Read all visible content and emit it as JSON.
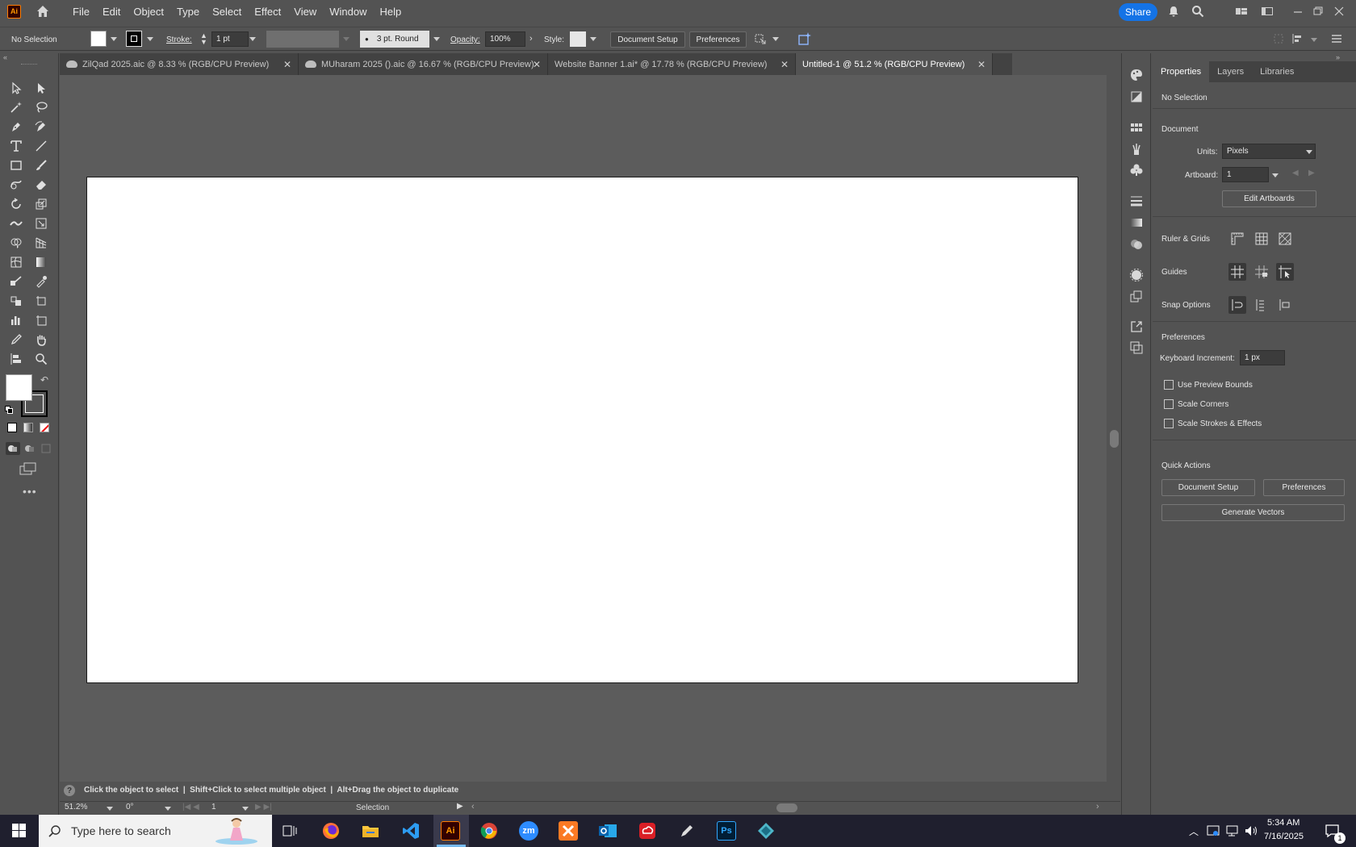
{
  "app": {
    "logo_text": "Ai",
    "menus": [
      "File",
      "Edit",
      "Object",
      "Type",
      "Select",
      "Effect",
      "View",
      "Window",
      "Help"
    ],
    "share_label": "Share"
  },
  "control_bar": {
    "selection_status": "No Selection",
    "stroke_label": "Stroke:",
    "stroke_value": "1 pt",
    "brush_value": "3 pt. Round",
    "opacity_label": "Opacity:",
    "opacity_value": "100%",
    "style_label": "Style:",
    "document_setup": "Document Setup",
    "preferences": "Preferences"
  },
  "tabs": [
    {
      "label": "ZilQad 2025.aic @ 8.33 % (RGB/CPU Preview)",
      "cloud": true,
      "active": false
    },
    {
      "label": "MUharam 2025 ().aic @ 16.67 % (RGB/CPU Preview)",
      "cloud": true,
      "active": false
    },
    {
      "label": "Website Banner 1.ai* @ 17.78 % (RGB/CPU Preview)",
      "cloud": false,
      "active": false
    },
    {
      "label": "Untitled-1 @ 51.2 % (RGB/CPU Preview)",
      "cloud": false,
      "active": true
    }
  ],
  "status_bar": {
    "hint": "Click the object to select  |  Shift+Click to select multiple object  |  Alt+Drag the object to duplicate",
    "zoom": "51.2%",
    "rotation": "0°",
    "artboard_num": "1",
    "tool": "Selection"
  },
  "properties": {
    "tabs": [
      "Properties",
      "Layers",
      "Libraries"
    ],
    "selection": "No Selection",
    "document_head": "Document",
    "units_label": "Units:",
    "units_value": "Pixels",
    "artboard_label": "Artboard:",
    "artboard_value": "1",
    "edit_artboards": "Edit Artboards",
    "ruler_grids": "Ruler & Grids",
    "guides": "Guides",
    "snap_options": "Snap Options",
    "preferences_head": "Preferences",
    "keyboard_increment_label": "Keyboard Increment:",
    "keyboard_increment_value": "1 px",
    "use_preview_bounds": "Use Preview Bounds",
    "scale_corners": "Scale Corners",
    "scale_strokes": "Scale Strokes & Effects",
    "quick_actions": "Quick Actions",
    "document_setup": "Document Setup",
    "preferences": "Preferences",
    "generate_vectors": "Generate Vectors"
  },
  "taskbar": {
    "search_placeholder": "Type here to search",
    "time": "5:34 AM",
    "date": "7/16/2025",
    "notification_count": "1",
    "app_labels": {
      "illustrator": "Ai",
      "zoom": "zm",
      "photoshop": "Ps"
    }
  }
}
